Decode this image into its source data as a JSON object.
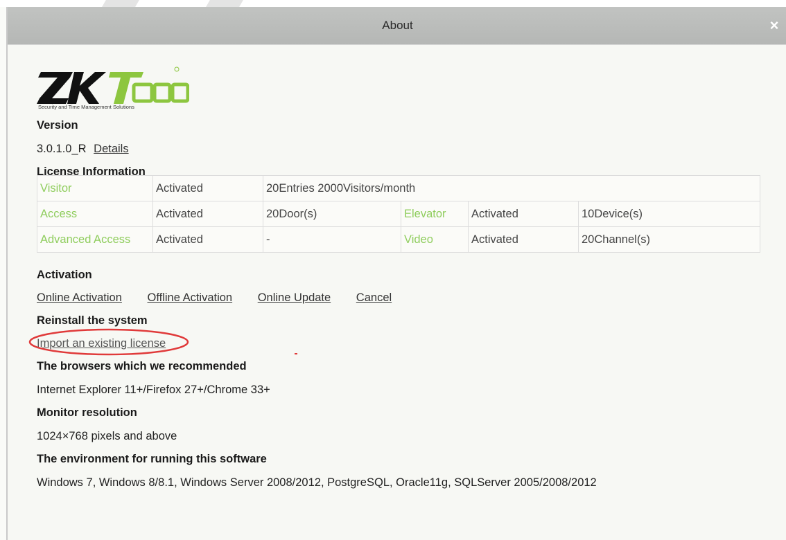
{
  "window": {
    "title": "About",
    "close_glyph": "×"
  },
  "logo": {
    "brand_text": "ZKTeco",
    "registered_mark": "®",
    "tagline": "Security and Time Management Solutions",
    "brand_color": "#8dc63f"
  },
  "version": {
    "heading": "Version",
    "value": "3.0.1.0_R",
    "details_link": "Details"
  },
  "license": {
    "heading": "License Information",
    "rows": [
      {
        "cells": [
          "Visitor",
          "Activated",
          "20Entries 2000Visitors/month"
        ]
      },
      {
        "cells": [
          "Access",
          "Activated",
          "20Door(s)",
          "Elevator",
          "Activated",
          "10Device(s)"
        ]
      },
      {
        "cells": [
          "Advanced Access",
          "Activated",
          "-",
          "Video",
          "Activated",
          "20Channel(s)"
        ]
      }
    ]
  },
  "activation": {
    "heading": "Activation",
    "links": {
      "online_activation": "Online Activation",
      "offline_activation": "Offline Activation",
      "online_update": "Online Update",
      "cancel": "Cancel"
    }
  },
  "reinstall": {
    "heading": "Reinstall the system",
    "import_link": "Import an existing license"
  },
  "browsers": {
    "heading": "The browsers which we recommended",
    "value": "Internet Explorer 11+/Firefox 27+/Chrome 33+"
  },
  "monitor": {
    "heading": "Monitor resolution",
    "value": "1024×768 pixels and above"
  },
  "environment": {
    "heading": "The environment for running this software",
    "value": "Windows 7, Windows 8/8.1, Windows Server 2008/2012, PostgreSQL, Oracle11g, SQLServer 2005/2008/2012"
  },
  "colors": {
    "module_label": "#8fcd5d",
    "annotation_circle": "#e03a3a",
    "titlebar": "#bcbebc"
  }
}
